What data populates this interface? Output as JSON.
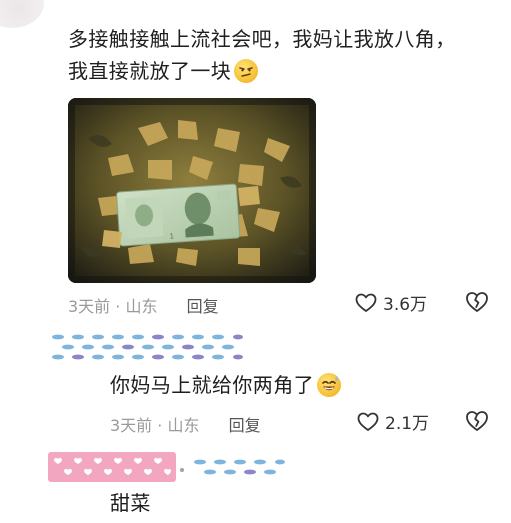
{
  "comment": {
    "text_line1": "多接触接触上流社会吧，我妈让我放八角，",
    "text_line2": "我直接就放了一块",
    "emoji": "smirk-face-emoji",
    "meta": {
      "time": "3天前",
      "separator": "·",
      "location": "山东",
      "reply_label": "回复"
    },
    "likes": "3.6万"
  },
  "replies": [
    {
      "text": "你妈马上就给你两角了",
      "emoji": "grinning-sweat-face-emoji",
      "meta": {
        "time": "3天前",
        "separator": "·",
        "location": "山东",
        "reply_label": "回复"
      },
      "likes": "2.1万"
    },
    {
      "text": "甜菜"
    }
  ],
  "colors": {
    "meta_gray": "#9a9a9a",
    "text_dark": "#1f1f1f",
    "name_blue": "#7fb4dd",
    "name_purple": "#8a86c9",
    "name_pink": "#f3a6bf"
  }
}
